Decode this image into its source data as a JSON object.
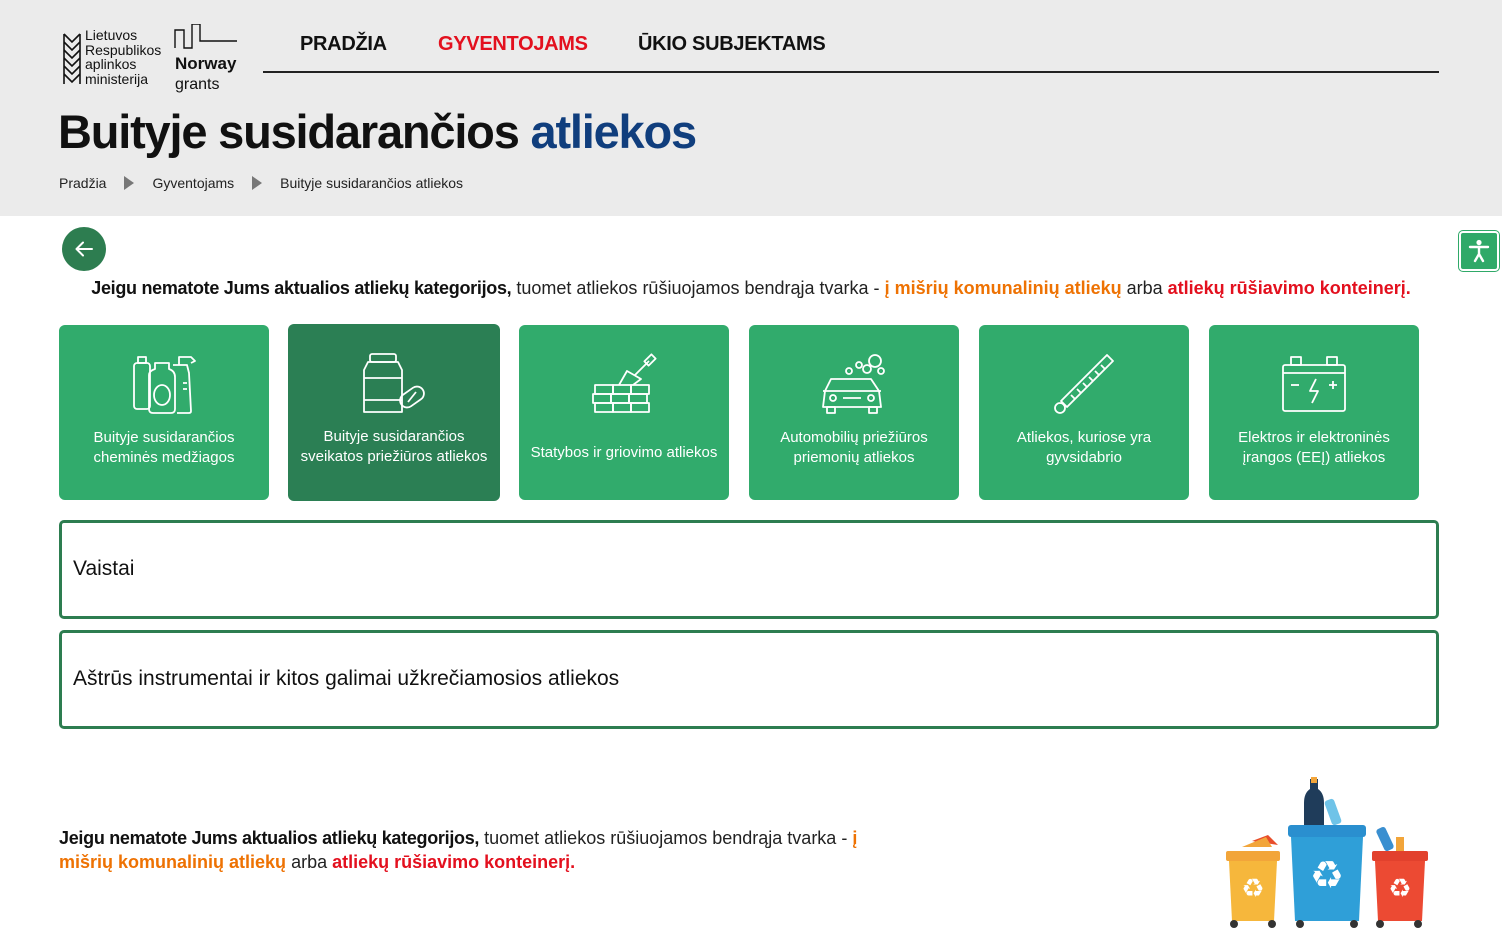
{
  "header": {
    "ministry_logo_lines": [
      "Lietuvos",
      "Respublikos",
      "aplinkos",
      "ministerija"
    ],
    "norway_logo": {
      "line1": "Norway",
      "line2": "grants"
    },
    "nav": [
      {
        "label": "PRADŽIA",
        "active": false
      },
      {
        "label": "GYVENTOJAMS",
        "active": true
      },
      {
        "label": "ŪKIO SUBJEKTAMS",
        "active": false
      }
    ],
    "title_main": "Buityje susidarančios",
    "title_accent": "atliekos",
    "breadcrumb": [
      "Pradžia",
      "Gyventojams",
      "Buityje susidarančios atliekos"
    ]
  },
  "notice": {
    "bold": "Jeigu nematote Jums aktualios atliekų kategorijos,",
    "text": " tuomet atliekos rūšiuojamos bendrąja tvarka - ",
    "orange": "į mišrių komunalinių atliekų",
    "middle": " arba ",
    "red": "atliekų rūšiavimo konteinerį."
  },
  "categories": [
    {
      "line1": "Buityje susidarančios",
      "line2": "cheminės medžiagos",
      "icon": "chemical-bottles-icon",
      "active": false
    },
    {
      "line1": "Buityje susidarančios",
      "line2": "sveikatos priežiūros atliekos",
      "icon": "medicine-pills-icon",
      "active": true
    },
    {
      "line1": "Statybos ir griovimo atliekos",
      "line2": "",
      "icon": "bricks-trowel-icon",
      "active": false
    },
    {
      "line1": "Automobilių priežiūros",
      "line2": "priemonių atliekos",
      "icon": "car-wash-icon",
      "active": false
    },
    {
      "line1": "Atliekos, kuriose yra",
      "line2": "gyvsidabrio",
      "icon": "thermometer-icon",
      "active": false
    },
    {
      "line1": "Elektros ir elektroninės",
      "line2": "įrangos (EEĮ) atliekos",
      "icon": "battery-icon",
      "active": false
    }
  ],
  "accordion": [
    "Vaistai",
    "Aštrūs instrumentai ir kitos galimai užkrečiamosios atliekos"
  ],
  "colors": {
    "green": "#31ab6c",
    "dark_green": "#2b7f54",
    "navy": "#103e7d",
    "red": "#e3101e",
    "orange": "#ee7203"
  }
}
